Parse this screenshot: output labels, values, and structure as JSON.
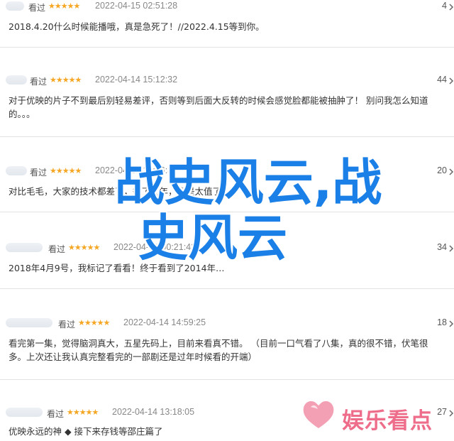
{
  "reviews": [
    {
      "rating_label": "看过",
      "stars": "★★★★★",
      "date": "2022-04-15 02:51:28",
      "likes": "4",
      "text": "2018.4.20什么时候能播哦，真是急死了！//2022.4.15等到你。"
    },
    {
      "rating_label": "看过",
      "stars": "★★★★★",
      "date": "2022-04-14 15:12:32",
      "likes": "44",
      "text": "对于优映的片子不到最后别轻易差评，否则等到后面大反转的时候会感觉脸都能被抽肿了！ 别问我怎么知道的。。。"
    },
    {
      "rating_label": "看过",
      "stars": "★★★★★",
      "date": "2022-04-14 13:36:37",
      "likes": "20",
      "text": "对比毛毛，大家的技术都差了，等了几年，真是太值了！"
    },
    {
      "rating_label": "看过",
      "stars": "★★★★★",
      "date": "2022-04-15 00:21:43",
      "likes": "34",
      "text": "2018年4月9号，我标记了看看！终于看到了2014年…"
    },
    {
      "rating_label": "看过",
      "stars": "★★★★★",
      "date": "2022-04-14 14:59:25",
      "likes": "18",
      "text": "看完第一集，觉得脑洞真大，五星先码上，目前来看真不错。 （目前一口气看了八集，真的很不错，伏笔很多。上次还让我认真完整看完的一部剧还是过年时候看的开端）"
    },
    {
      "rating_label": "看过",
      "stars": "★★★★★",
      "date": "2022-04-14 13:18:05",
      "likes": "27",
      "text": "优映永远的神 ◆ 接下来存钱等邵庄篇了"
    }
  ],
  "overlay": {
    "line1": "战史风云,战",
    "line2": "史风云"
  },
  "watermark": {
    "text": "娱乐看点"
  },
  "colors": {
    "star": "#f5a623",
    "overlay": "#1a7fe6",
    "watermark": "#ee6d8a"
  }
}
